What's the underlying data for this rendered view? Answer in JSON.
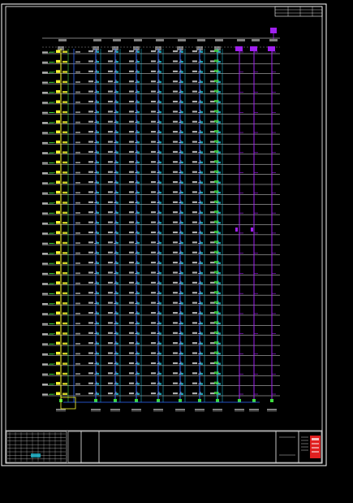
{
  "drawing": {
    "background": "#000000",
    "frame_color": "#ffffff",
    "colors": {
      "floor_line": "#ffffff",
      "riser_main": "#2f6bff",
      "riser_cyan": "#22d3ee",
      "riser_purple": "#a020f0",
      "label_green": "#3ddc3d",
      "label_yellow": "#ffff33",
      "fixture_white": "#e6e6e6",
      "stamp_red": "#e02020"
    },
    "floor_count": 35,
    "riser_groups": [
      {
        "kind": "yellow",
        "color_key": "label_yellow"
      },
      {
        "kind": "blue",
        "color_key": "riser_main"
      },
      {
        "kind": "blue",
        "color_key": "riser_main"
      },
      {
        "kind": "blue",
        "color_key": "riser_main"
      },
      {
        "kind": "blue",
        "color_key": "riser_main"
      },
      {
        "kind": "blue",
        "color_key": "riser_main"
      },
      {
        "kind": "blue",
        "color_key": "riser_main"
      },
      {
        "kind": "cyan",
        "color_key": "riser_cyan"
      },
      {
        "kind": "purple",
        "color_key": "riser_purple"
      },
      {
        "kind": "purple",
        "color_key": "riser_purple"
      },
      {
        "kind": "purple",
        "color_key": "riser_purple"
      }
    ]
  }
}
